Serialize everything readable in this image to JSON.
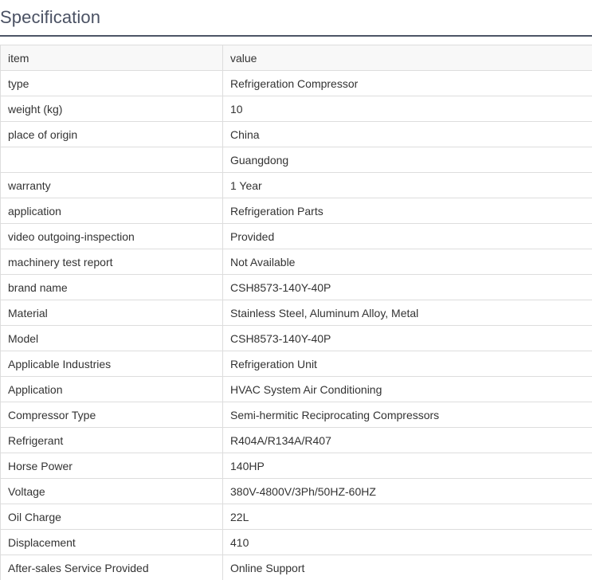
{
  "page": {
    "title": "Specification"
  },
  "table": {
    "header": {
      "item": "item",
      "value": "value"
    },
    "rows": [
      {
        "item": "type",
        "value": "Refrigeration Compressor"
      },
      {
        "item": "weight (kg)",
        "value": "10"
      },
      {
        "item": "place of origin",
        "value": "China"
      },
      {
        "item": "",
        "value": "Guangdong"
      },
      {
        "item": "warranty",
        "value": "1 Year"
      },
      {
        "item": "application",
        "value": "Refrigeration Parts"
      },
      {
        "item": "video outgoing-inspection",
        "value": "Provided"
      },
      {
        "item": "machinery test report",
        "value": "Not Available"
      },
      {
        "item": "brand name",
        "value": "CSH8573-140Y-40P"
      },
      {
        "item": "Material",
        "value": "Stainless Steel, Aluminum Alloy, Metal"
      },
      {
        "item": "Model",
        "value": "CSH8573-140Y-40P"
      },
      {
        "item": "Applicable Industries",
        "value": "Refrigeration Unit"
      },
      {
        "item": "Application",
        "value": "HVAC System Air Conditioning"
      },
      {
        "item": "Compressor Type",
        "value": "Semi-hermitic Reciprocating Compressors"
      },
      {
        "item": "Refrigerant",
        "value": "R404A/R134A/R407"
      },
      {
        "item": "Horse Power",
        "value": "140HP"
      },
      {
        "item": "Voltage",
        "value": "380V-4800V/3Ph/50HZ-60HZ"
      },
      {
        "item": "Oil Charge",
        "value": "22L"
      },
      {
        "item": "Displacement",
        "value": "410"
      },
      {
        "item": "After-sales Service Provided",
        "value": "Online Support"
      }
    ]
  }
}
